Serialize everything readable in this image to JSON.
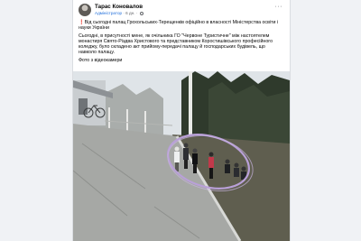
{
  "post": {
    "author": "Тарас Коновалов",
    "role": "Адміністратор",
    "time": "6 дн.",
    "paragraph1": "Від сьогодні палац Грохольських-Терещенків офіційно в власності Міністерства освіти і науки України",
    "paragraph2": "Сьогодні, в присутності мене, як очільника ГО \"Червоне Туристичне\" між настоятелем монастиря Свято-Різдва Христового та представником Коростишівського професійного коледжу, було складено акт прийому-передачі палацу й господарських будівель, що навколо палацу.",
    "paragraph3": "Фото з відеокамери"
  },
  "colors": {
    "accent": "#216fdb",
    "alert": "#e41e3f",
    "annotation_circle": "#b9a0d8"
  },
  "icons": [
    "avatar",
    "globe-icon",
    "more-icon",
    "exclamation-icon"
  ]
}
